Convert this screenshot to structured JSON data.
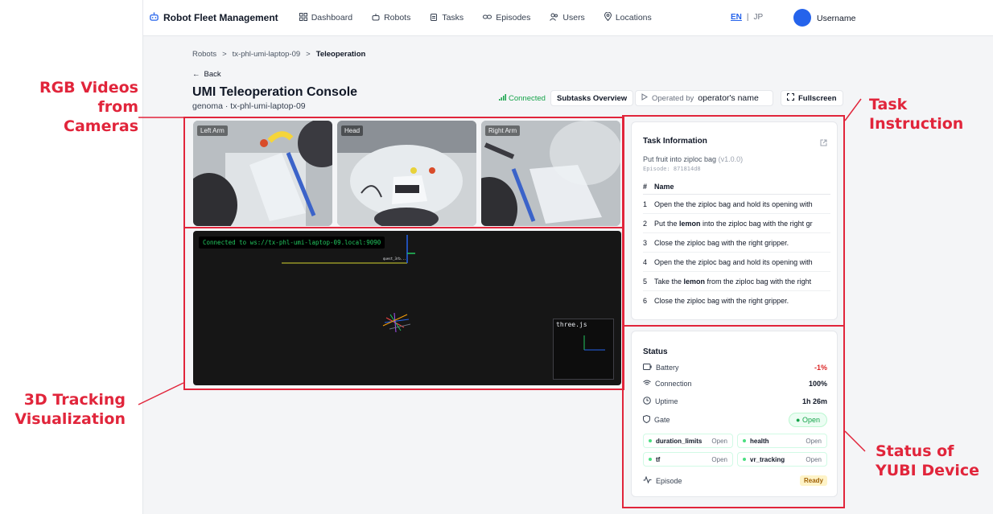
{
  "app": {
    "brand": "Robot Fleet Management",
    "nav": [
      {
        "label": "Dashboard",
        "icon": "grid-icon"
      },
      {
        "label": "Robots",
        "icon": "robot-icon"
      },
      {
        "label": "Tasks",
        "icon": "clipboard-icon"
      },
      {
        "label": "Episodes",
        "icon": "link-icon"
      },
      {
        "label": "Users",
        "icon": "users-icon"
      },
      {
        "label": "Locations",
        "icon": "pin-icon"
      }
    ],
    "lang": {
      "en": "EN",
      "sep": "|",
      "jp": "JP"
    },
    "username": "Username"
  },
  "breadcrumb": {
    "root": "Robots",
    "robot": "tx-phl-umi-laptop-09",
    "current": "Teleoperation",
    "sep": ">"
  },
  "back_label": "Back",
  "page": {
    "title": "UMI Teleoperation Console",
    "subtitle": "genoma · tx-phl-umi-laptop-09"
  },
  "toolbar": {
    "connection": "Connected",
    "subtasks": "Subtasks Overview",
    "operated_by": "Operated by",
    "operator": "operator's name",
    "fullscreen": "Fullscreen"
  },
  "cameras": [
    {
      "label": "Left Arm"
    },
    {
      "label": "Head"
    },
    {
      "label": "Right Arm"
    }
  ],
  "viz": {
    "connection": "Connected to ws://tx-phl-umi-laptop-09.local:9090",
    "axis_label": "quest_3rb...",
    "inset_label": "three.js"
  },
  "task": {
    "title": "Task Information",
    "name": "Put fruit into ziploc bag",
    "version": "(v1.0.0)",
    "episode": "Episode: 871814d8",
    "columns": [
      "#",
      "Name"
    ],
    "steps": [
      {
        "n": "1",
        "pre": "Open the the ziploc bag and hold its opening with",
        "bold": "",
        "post": ""
      },
      {
        "n": "2",
        "pre": "Put the ",
        "bold": "lemon",
        "post": " into the ziploc bag with the right gr"
      },
      {
        "n": "3",
        "pre": "Close the ziploc bag with the right gripper.",
        "bold": "",
        "post": ""
      },
      {
        "n": "4",
        "pre": "Open the the ziploc bag and hold its opening with",
        "bold": "",
        "post": ""
      },
      {
        "n": "5",
        "pre": "Take the ",
        "bold": "lemon",
        "post": " from the ziploc bag with the right"
      },
      {
        "n": "6",
        "pre": "Close the ziploc bag with the right gripper.",
        "bold": "",
        "post": ""
      }
    ]
  },
  "status": {
    "title": "Status",
    "battery": {
      "label": "Battery",
      "value": "-1%"
    },
    "connection": {
      "label": "Connection",
      "value": "100%"
    },
    "uptime": {
      "label": "Uptime",
      "value": "1h 26m"
    },
    "gate": {
      "label": "Gate",
      "value": "Open"
    },
    "gates": [
      {
        "name": "duration_limits",
        "value": "Open"
      },
      {
        "name": "health",
        "value": "Open"
      },
      {
        "name": "tf",
        "value": "Open"
      },
      {
        "name": "vr_tracking",
        "value": "Open"
      }
    ],
    "episode": {
      "label": "Episode",
      "value": "Ready"
    }
  },
  "annotations": {
    "rgb": [
      "RGB Videos",
      "from Cameras"
    ],
    "tracking": [
      "3D Tracking",
      "Visualization"
    ],
    "task": [
      "Task",
      "Instruction"
    ],
    "status": [
      "Status of",
      "YUBI Device"
    ]
  },
  "colors": {
    "accent": "#2563eb",
    "annotation": "#e1253b",
    "ok": "#16a34a",
    "warn": "#dc2626"
  }
}
